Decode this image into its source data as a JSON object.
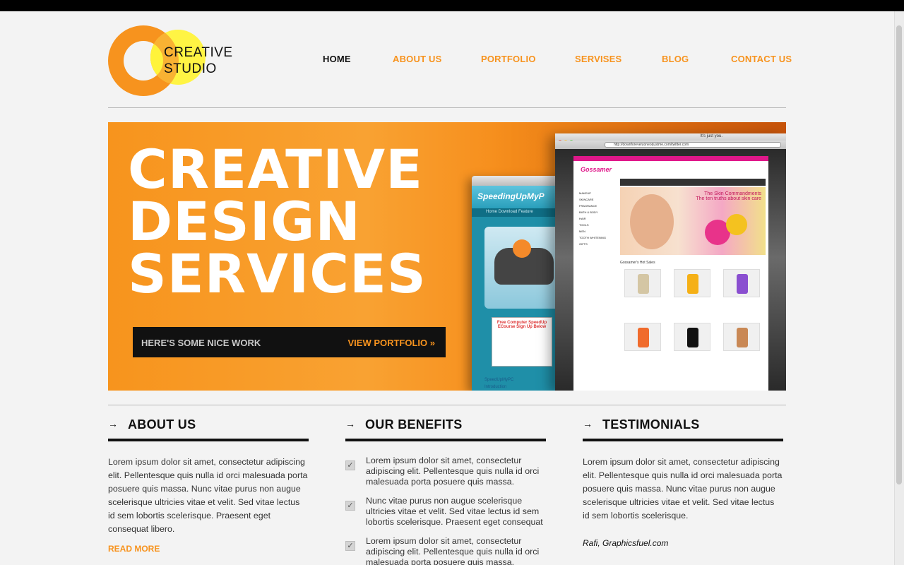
{
  "logo": {
    "line1": "CREATIVE",
    "line2": "STUDIO"
  },
  "nav": {
    "items": [
      "HOME",
      "ABOUT US",
      "PORTFOLIO",
      "SERVISES",
      "BLOG",
      "CONTACT US"
    ],
    "active": "HOME"
  },
  "hero": {
    "title_lines": [
      "CREATIVE",
      "DESIGN",
      "SERVICES"
    ],
    "cta_text": "HERE'S SOME NICE WORK",
    "cta_link": "VIEW PORTFOLIO »",
    "mock_back": {
      "title": "SpeedingUpMyP",
      "menu": "Home   Download   Feature",
      "form_title": "Free Computer SpeedUp ECourse Sign Up Below",
      "links": [
        "SpeedUpMyPC",
        "Introduction"
      ]
    },
    "mock_front": {
      "window_title": "It's just you.",
      "url": "http://downforeveryoneorjustme.com/twitter.com",
      "site_logo": "Gossamer",
      "banner_text": "The Skin Commandments",
      "banner_sub": "The ten truths about skin care",
      "hot_sales": "Gossamer's Hot Sales",
      "side_menu": [
        "MAKEUP",
        "SKINCARE",
        "FRAGRANCE",
        "BATH & BODY",
        "HAIR",
        "TOOLS",
        "MEN",
        "TOOTH WHITENING",
        "GIFTS"
      ]
    }
  },
  "about": {
    "heading": "ABOUT US",
    "text": "Lorem ipsum dolor sit amet, consectetur adipiscing elit. Pellentesque quis nulla id orci malesuada porta posuere quis massa. Nunc vitae purus non augue scelerisque ultricies vitae et velit. Sed vitae lectus id sem lobortis scelerisque. Praesent eget consequat libero.",
    "read_more": "READ MORE"
  },
  "benefits": {
    "heading": "OUR BENEFITS",
    "items": [
      "Lorem ipsum dolor sit amet, consectetur adipiscing elit. Pellentesque quis nulla id orci malesuada porta posuere quis massa.",
      "Nunc vitae purus non augue scelerisque ultricies vitae et velit. Sed vitae lectus id sem lobortis scelerisque. Praesent eget consequat",
      "Lorem ipsum dolor sit amet, consectetur adipiscing elit. Pellentesque quis nulla id orci malesuada porta posuere quis massa."
    ]
  },
  "testimonials": {
    "heading": "TESTIMONIALS",
    "text": "Lorem ipsum dolor sit amet, consectetur adipiscing elit. Pellentesque quis nulla id orci malesuada porta posuere quis massa. Nunc vitae purus non augue scelerisque ultricies vitae et velit. Sed vitae lectus id sem lobortis scelerisque.",
    "author": "Rafi, Graphicsfuel.com"
  },
  "icons": {
    "section_arrow": "→",
    "check": "✓"
  },
  "colors": {
    "accent": "#f7931e",
    "logo_yellow": "#fff33a",
    "dark": "#111111",
    "background": "#f3f3f3"
  }
}
